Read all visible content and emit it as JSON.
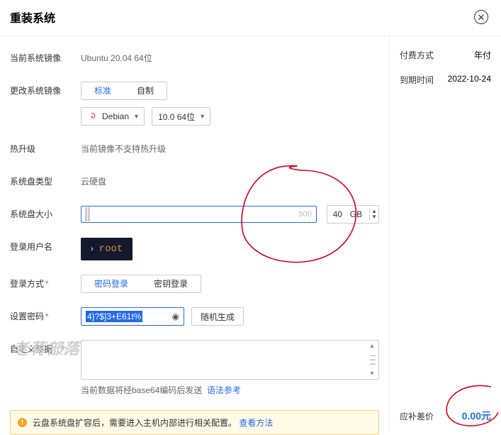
{
  "title": "重装系统",
  "labels": {
    "current_image": "当前系统镜像",
    "change_image": "更改系统镜像",
    "hot_upgrade": "热升级",
    "disk_type": "系统盘类型",
    "disk_size": "系统盘大小",
    "login_user": "登录用户名",
    "login_method": "登录方式",
    "set_password": "设置密码",
    "custom_data": "自定义数据"
  },
  "current_image": "Ubuntu 20.04 64位",
  "image_tabs": {
    "standard": "标准",
    "custom": "自制"
  },
  "os_select": {
    "name": "Debian",
    "version": "10.0 64位"
  },
  "hot_upgrade_text": "当前镜像不支持热升级",
  "disk_type_text": "云硬盘",
  "slider_max": "500",
  "disk_size": {
    "value": "40",
    "unit": "GB"
  },
  "login_user": "root",
  "login_method": {
    "pw": "密码登录",
    "key": "密钥登录"
  },
  "password": "4}?$]3+E61t%",
  "random_btn": "随机生成",
  "ta_hint_prefix": "当前数据将经base64编码后发送",
  "ta_hint_link": "语法参考",
  "alert_text": "云盘系统盘扩容后，需要进入主机内部进行相关配置。",
  "alert_link": "查看方法",
  "right": {
    "pay_method_k": "付费方式",
    "pay_method_v": "年付",
    "expire_k": "到期时间",
    "expire_v": "2022-10-24",
    "price_k": "应补差价",
    "price_v": "0.00元"
  },
  "watermark": "老蒋部落"
}
